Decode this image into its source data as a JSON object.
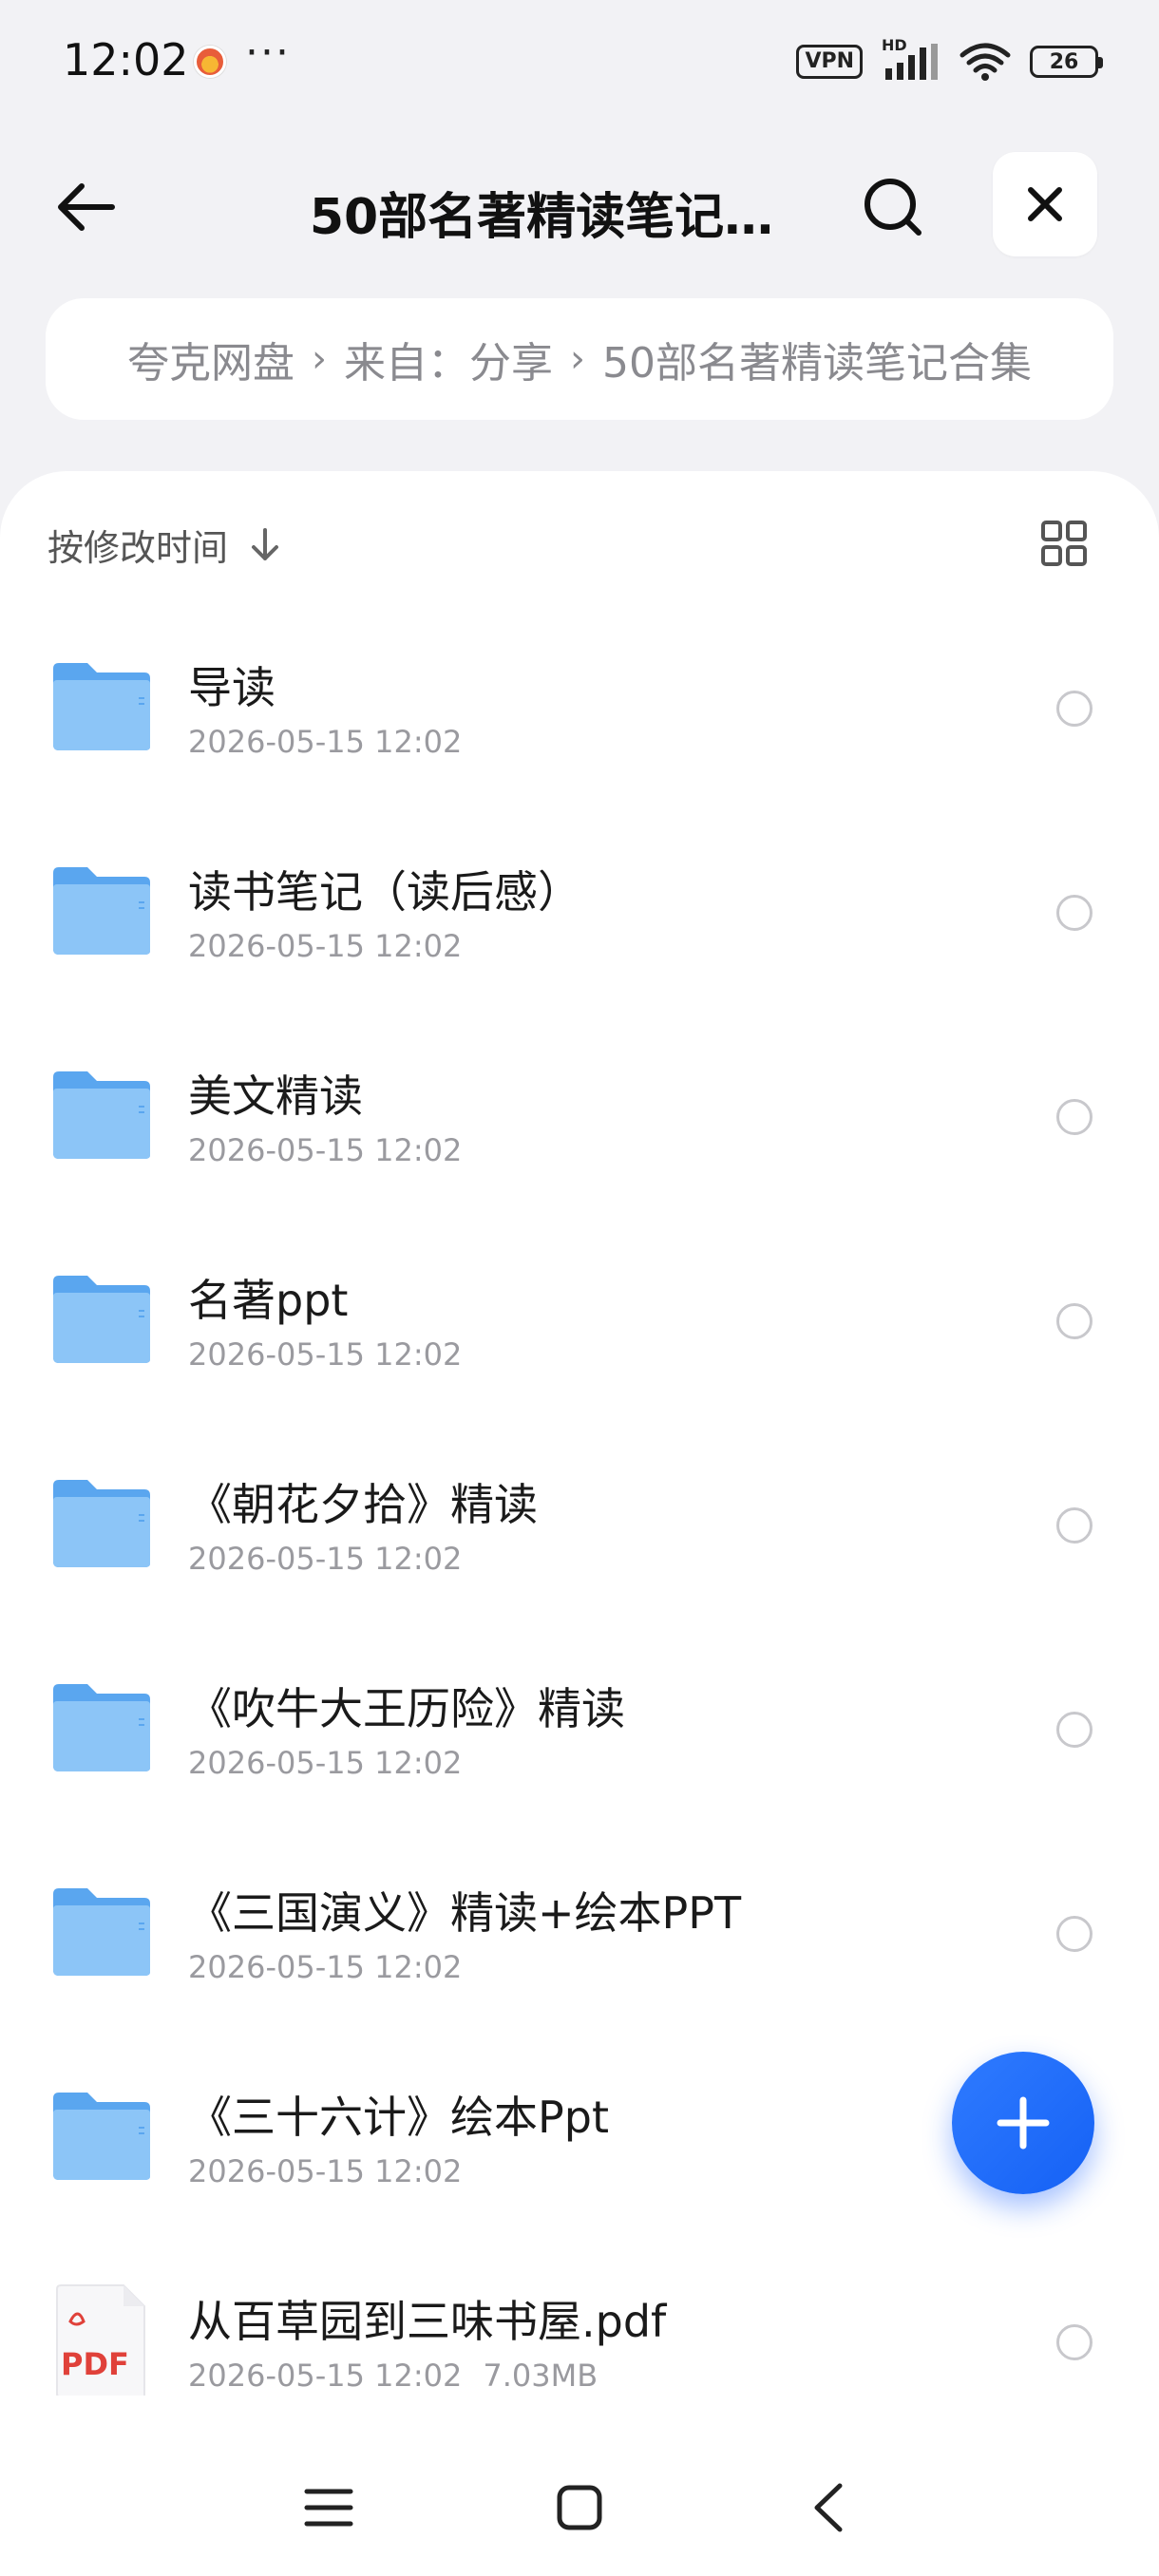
{
  "status_bar": {
    "time": "12:02",
    "more": "···",
    "vpn": "VPN",
    "hd": "HD",
    "battery": "26"
  },
  "header": {
    "title": "50部名著精读笔记…"
  },
  "breadcrumb": {
    "items": [
      "夸克网盘",
      "来自：分享",
      "50部名著精读笔记合集"
    ],
    "separator": "›"
  },
  "sort": {
    "label": "按修改时间"
  },
  "files": [
    {
      "name": "导读",
      "date": "2026-05-15 12:02",
      "size": "",
      "type": "folder"
    },
    {
      "name": "读书笔记（读后感）",
      "date": "2026-05-15 12:02",
      "size": "",
      "type": "folder"
    },
    {
      "name": "美文精读",
      "date": "2026-05-15 12:02",
      "size": "",
      "type": "folder"
    },
    {
      "name": "名著ppt",
      "date": "2026-05-15 12:02",
      "size": "",
      "type": "folder"
    },
    {
      "name": "《朝花夕拾》精读",
      "date": "2026-05-15 12:02",
      "size": "",
      "type": "folder"
    },
    {
      "name": "《吹牛大王历险》精读",
      "date": "2026-05-15 12:02",
      "size": "",
      "type": "folder"
    },
    {
      "name": "《三国演义》精读+绘本PPT",
      "date": "2026-05-15 12:02",
      "size": "",
      "type": "folder"
    },
    {
      "name": "《三十六计》绘本Ppt",
      "date": "2026-05-15 12:02",
      "size": "",
      "type": "folder"
    },
    {
      "name": "从百草园到三味书屋.pdf",
      "date": "2026-05-15 12:02",
      "size": "7.03MB",
      "type": "pdf"
    }
  ],
  "pdf_badge": "PDF",
  "colors": {
    "accent": "#1e6cff",
    "folder": "#7ab8f5",
    "pdf_red": "#e0413a"
  }
}
